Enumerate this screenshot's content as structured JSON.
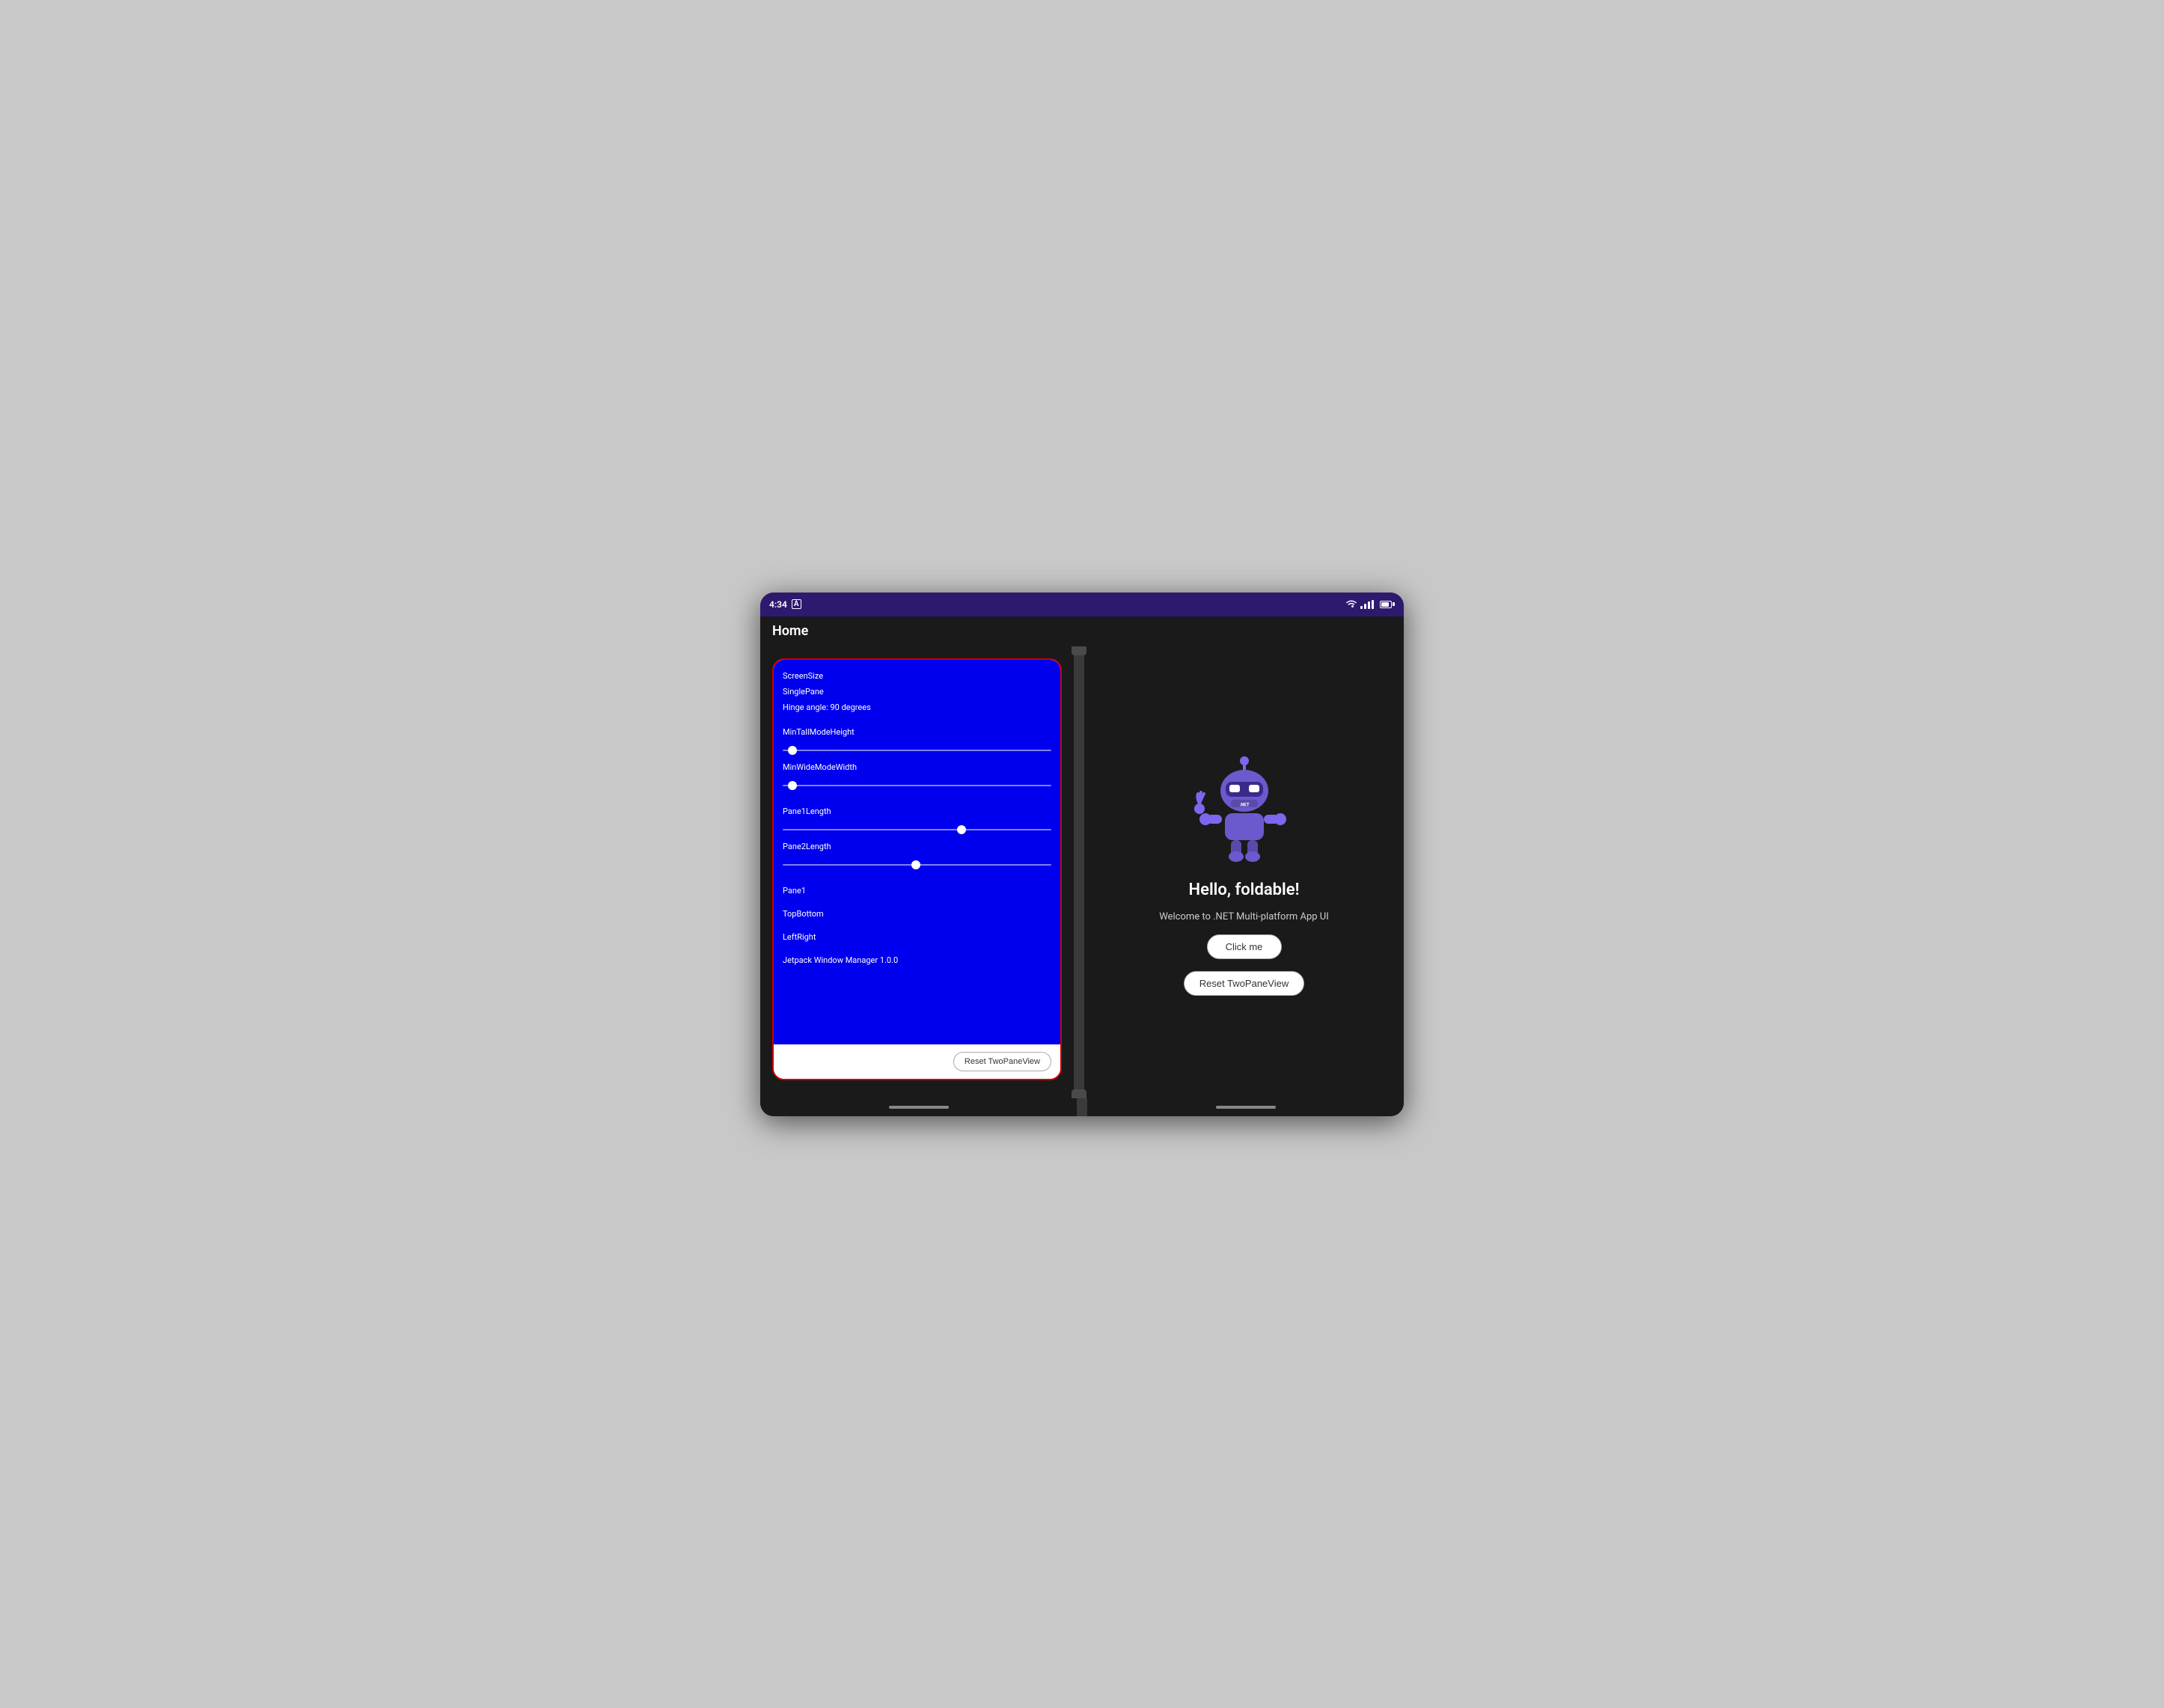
{
  "device": {
    "status_bar": {
      "time": "4:34",
      "accessibility_label": "A"
    },
    "app_bar": {
      "title": "Home"
    }
  },
  "left_pane": {
    "info_lines": {
      "screen_size": "ScreenSize",
      "single_pane": "SinglePane",
      "hinge_angle": "Hinge angle: 90 degrees"
    },
    "sliders": {
      "min_tall_label": "MinTallModeHeight",
      "min_wide_label": "MinWideModeWidth",
      "pane1_length_label": "Pane1Length",
      "pane2_length_label": "Pane2Length"
    },
    "labels": {
      "pane1": "Pane1",
      "top_bottom": "TopBottom",
      "left_right": "LeftRight",
      "jetpack": "Jetpack Window Manager 1.0.0"
    },
    "reset_button": "Reset TwoPaneView"
  },
  "right_pane": {
    "hello_text": "Hello, foldable!",
    "welcome_text": "Welcome to .NET Multi-platform App UI",
    "click_button": "Click me",
    "reset_button": "Reset TwoPaneView"
  }
}
